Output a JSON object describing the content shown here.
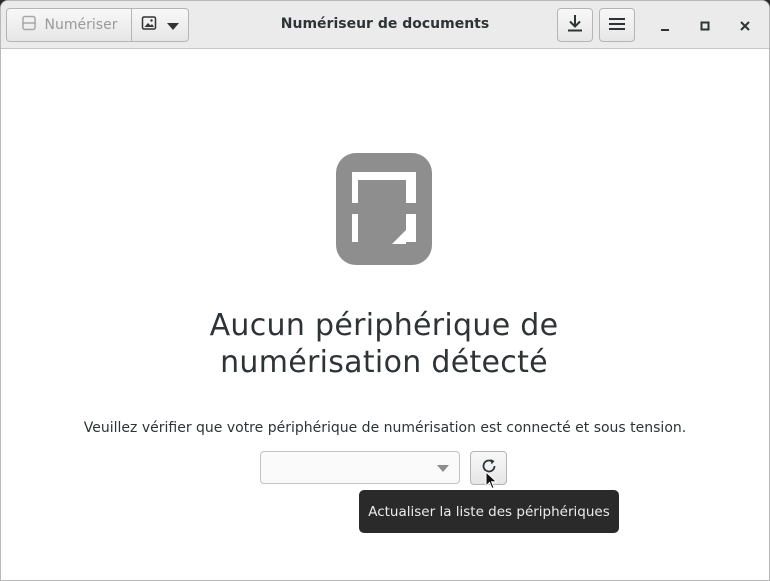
{
  "window": {
    "title": "Numériseur de documents"
  },
  "toolbar": {
    "scan_label": "Numériser",
    "scan_icon": "scanner-icon",
    "type_icon": "image-icon",
    "save_icon": "download-icon",
    "menu_icon": "hamburger-menu-icon"
  },
  "window_controls": [
    "minimize-icon",
    "maximize-icon",
    "close-icon"
  ],
  "main": {
    "heading_line1": "Aucun périphérique de",
    "heading_line2": "numérisation détecté",
    "description": "Veuillez vérifier que votre périphérique de numérisation est connecté et sous tension.",
    "device_combo_value": "",
    "tooltip": "Actualiser la liste des périphériques"
  },
  "colors": {
    "icon_gray": "#8e8e8e",
    "headerbar": "#ebebeb",
    "tooltip_bg": "#2a2a2a"
  }
}
